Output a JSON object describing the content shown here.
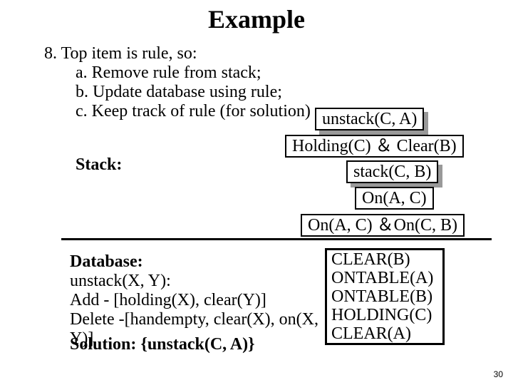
{
  "title": "Example",
  "bullet": {
    "num": "8. Top item is rule, so:",
    "a": "a. Remove rule from stack;",
    "b": "b. Update database using rule;",
    "c": "c. Keep track of rule (for solution)"
  },
  "stack_label": "Stack:",
  "stack": {
    "top_box": "unstack(C, A)",
    "row2": "Holding(C) ＆ Clear(B)",
    "row3": "stack(C, B)",
    "row4": "On(A, C)",
    "bottom": "On(A, C) ＆On(C, B)"
  },
  "database": {
    "label": "Database:",
    "line1": "unstack(X, Y):",
    "line2": "Add - [holding(X), clear(Y)]",
    "line3": "Delete -[handempty, clear(X), on(X, Y)]"
  },
  "db_box": {
    "l1": "CLEAR(B)",
    "l2": "ONTABLE(A)",
    "l3": "ONTABLE(B)",
    "l4": "HOLDING(C)",
    "l5": "CLEAR(A)"
  },
  "solution": "Solution: {unstack(C, A)}",
  "page": "30"
}
